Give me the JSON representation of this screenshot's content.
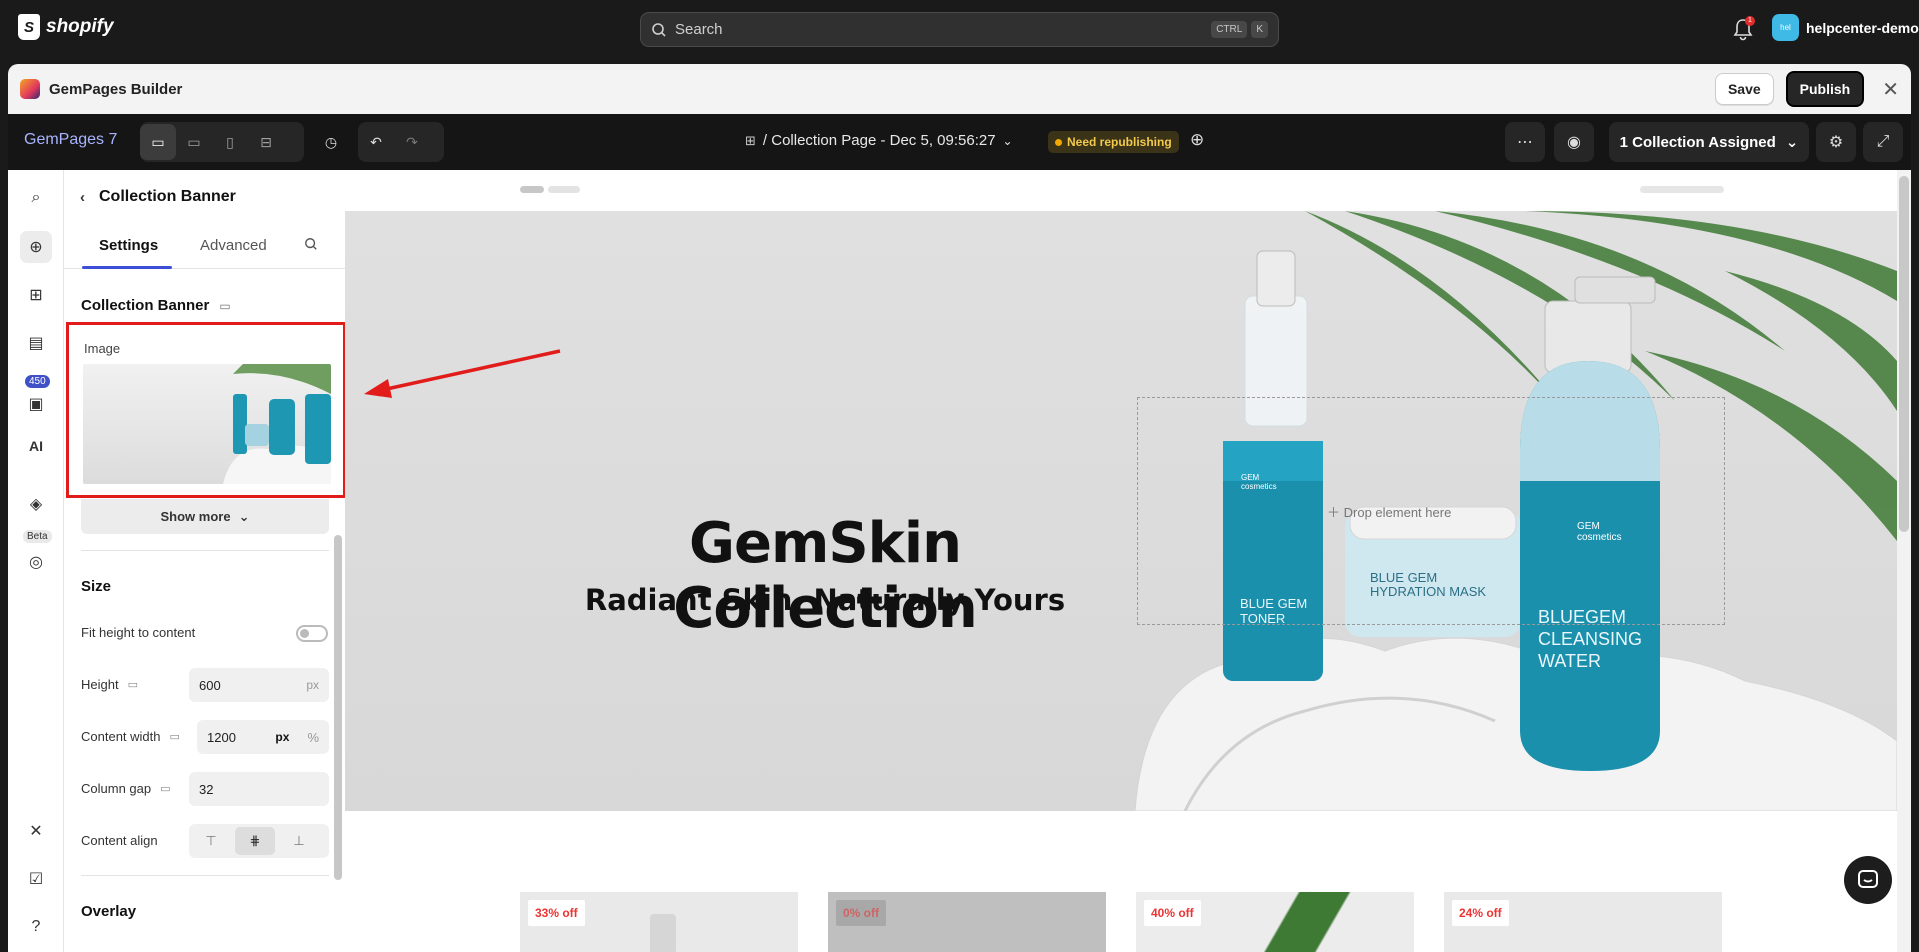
{
  "shopify": {
    "brand": "shopify",
    "search_placeholder": "Search",
    "kbd": [
      "CTRL",
      "K"
    ],
    "notif_count": "1",
    "avatar_text": "hel",
    "store_name": "helpcenter-demo"
  },
  "app": {
    "title": "GemPages Builder",
    "save_label": "Save",
    "publish_label": "Publish"
  },
  "toolbar": {
    "project": "GemPages 7",
    "breadcrumb": "/ Collection Page - Dec 5, 09:56:27",
    "status_badge": "Need republishing",
    "assign_label": "1 Collection Assigned"
  },
  "rail": {
    "badge": "450",
    "beta": "Beta",
    "ai": "AI"
  },
  "panel": {
    "title": "Collection Banner",
    "tabs": [
      "Settings",
      "Advanced"
    ],
    "section": "Collection Banner",
    "image_label": "Image",
    "show_more": "Show more",
    "size_heading": "Size",
    "fit_height": "Fit height to content",
    "height_label": "Height",
    "height_value": "600",
    "content_width_label": "Content width",
    "content_width_value": "1200",
    "column_gap_label": "Column gap",
    "column_gap_value": "32",
    "content_align_label": "Content align",
    "overlay_heading": "Overlay",
    "unit_px": "px",
    "unit_pct": "%"
  },
  "banner": {
    "title": "GemSkin Collection",
    "subtitle": "Radiant Skin, Naturally Yours",
    "drop_hint": "Drop element here",
    "products": {
      "toner_brand": "GEM cosmetics",
      "toner": "BLUE GEM TONER",
      "mask": "BLUE GEM HYDRATION MASK",
      "water": "BLUEGEM CLEANSING WATER",
      "water_brand": "GEM cosmetics"
    }
  },
  "cards": [
    "33% off",
    "0% off",
    "40% off",
    "24% off"
  ]
}
